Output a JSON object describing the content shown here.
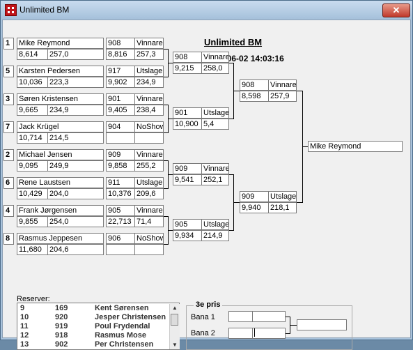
{
  "window": {
    "title": "Unlimited BM",
    "close_glyph": "✕"
  },
  "header": {
    "title": "Unlimited BM",
    "datetime": "2013-06-02 14:03:16"
  },
  "round1": [
    {
      "seed": "1",
      "name": "Mike Reymond",
      "v1": "8,614",
      "v2": "257,0"
    },
    {
      "seed": "5",
      "name": "Karsten Pedersen",
      "v1": "10,036",
      "v2": "223,3"
    },
    {
      "seed": "3",
      "name": "Søren Kristensen",
      "v1": "9,665",
      "v2": "234,9"
    },
    {
      "seed": "7",
      "name": "Jack Krügel",
      "v1": "10,714",
      "v2": "214,5"
    },
    {
      "seed": "2",
      "name": "Michael Jensen",
      "v1": "9,095",
      "v2": "249,9"
    },
    {
      "seed": "6",
      "name": "Rene Laustsen",
      "v1": "10,429",
      "v2": "204,0"
    },
    {
      "seed": "4",
      "name": "Frank Jørgensen",
      "v1": "9,855",
      "v2": "254,0"
    },
    {
      "seed": "8",
      "name": "Rasmus Jeppesen",
      "v1": "11,680",
      "v2": "204,6"
    }
  ],
  "round1_results": [
    {
      "num": "908",
      "result": "Vinnare",
      "v1": "8,816",
      "v2": "257,3"
    },
    {
      "num": "917",
      "result": "Utslagen",
      "v1": "9,902",
      "v2": "234,9"
    },
    {
      "num": "901",
      "result": "Vinnare",
      "v1": "9,405",
      "v2": "238,4"
    },
    {
      "num": "904",
      "result": "NoShow",
      "v1": "",
      "v2": ""
    },
    {
      "num": "909",
      "result": "Vinnare",
      "v1": "9,858",
      "v2": "255,2"
    },
    {
      "num": "911",
      "result": "Utslagen",
      "v1": "10,376",
      "v2": "209,6"
    },
    {
      "num": "905",
      "result": "Vinnare",
      "v1": "22,713",
      "v2": "71,4"
    },
    {
      "num": "906",
      "result": "NoShow",
      "v1": "",
      "v2": ""
    }
  ],
  "round2": [
    {
      "num": "908",
      "result": "Vinnare",
      "v1": "9,215",
      "v2": "258,0"
    },
    {
      "num": "901",
      "result": "Utslagen",
      "v1": "10,900",
      "v2": "5,4"
    },
    {
      "num": "909",
      "result": "Vinnare",
      "v1": "9,541",
      "v2": "252,1"
    },
    {
      "num": "905",
      "result": "Utslagen",
      "v1": "9,934",
      "v2": "214,9"
    }
  ],
  "semis": [
    {
      "num": "908",
      "result": "Vinnare",
      "v1": "8,598",
      "v2": "257,9"
    },
    {
      "num": "909",
      "result": "Utslagen",
      "v1": "9,940",
      "v2": "218,1"
    }
  ],
  "champion": "Mike Reymond",
  "reserves": {
    "label": "Reserver:",
    "rows": [
      {
        "pos": "9",
        "num": "169",
        "name": "Kent Sørensen"
      },
      {
        "pos": "10",
        "num": "920",
        "name": "Jesper Christensen"
      },
      {
        "pos": "11",
        "num": "919",
        "name": "Poul Frydendal"
      },
      {
        "pos": "12",
        "num": "918",
        "name": "Rasmus Mose"
      },
      {
        "pos": "13",
        "num": "902",
        "name": "Per Christensen"
      }
    ]
  },
  "third": {
    "label": "3e pris",
    "bana1": "Bana 1",
    "bana2": "Bana 2"
  }
}
